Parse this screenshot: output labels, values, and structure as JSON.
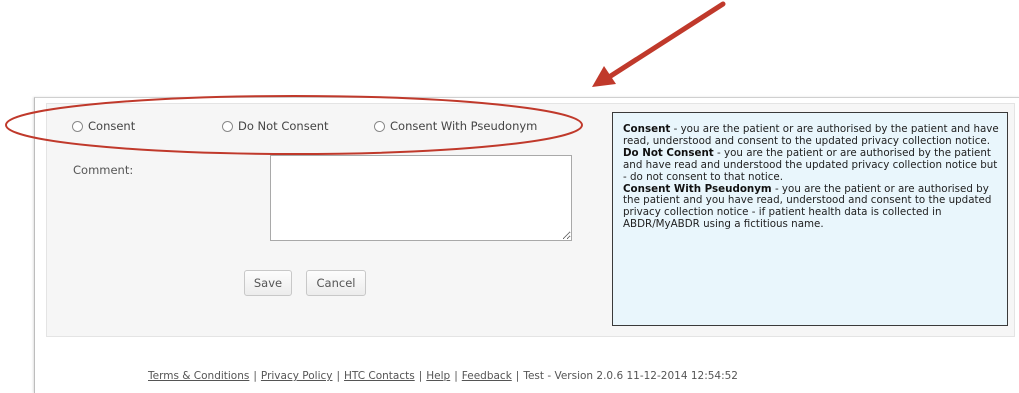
{
  "options": {
    "consent": "Consent",
    "do_not_consent": "Do Not Consent",
    "consent_with_pseudonym": "Consent With Pseudonym"
  },
  "comment_label": "Comment:",
  "buttons": {
    "save": "Save",
    "cancel": "Cancel"
  },
  "info": {
    "consent_title": "Consent",
    "consent_text": " - you are the patient or are authorised by the patient and have read, understood and consent to the updated privacy collection notice.",
    "do_not_consent_title": "Do Not Consent",
    "do_not_consent_text": " - you are the patient or are authorised by the patient and have read and understood the updated privacy collection notice but - do not consent to that notice.",
    "pseudonym_title": "Consent With Pseudonym",
    "pseudonym_text": " - you are the patient or are authorised by the patient and you have read, understood and consent to the updated privacy collection notice - if patient health data is collected in ABDR/MyABDR using a fictitious name."
  },
  "footer": {
    "terms": "Terms & Conditions",
    "privacy": "Privacy Policy",
    "contacts": "HTC Contacts",
    "help": "Help",
    "feedback": "Feedback",
    "version": "Test - Version 2.0.6 11-12-2014 12:54:52",
    "separator": "|"
  },
  "annotation_color": "#c0392b"
}
